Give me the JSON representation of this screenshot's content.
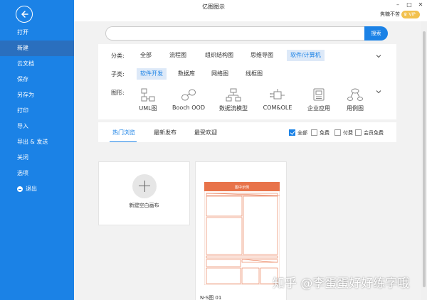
{
  "window": {
    "title": "亿图图示",
    "user": "焦糖不苦",
    "vip_badge": "VIP",
    "controls": [
      "–",
      "□",
      "✕"
    ]
  },
  "sidebar": {
    "items": [
      {
        "label": "打开"
      },
      {
        "label": "新建"
      },
      {
        "label": "云文档"
      },
      {
        "label": "保存"
      },
      {
        "label": "另存为"
      },
      {
        "label": "打印"
      },
      {
        "label": "导入"
      },
      {
        "label": "导出 & 发送"
      },
      {
        "label": "关闭"
      },
      {
        "label": "选项"
      },
      {
        "label": "退出"
      }
    ],
    "active_index": 1
  },
  "search": {
    "placeholder": "",
    "button_label": "搜索"
  },
  "filters": {
    "category": {
      "label": "分类:",
      "options": [
        "全部",
        "流程图",
        "组织结构图",
        "思维导图",
        "软件/计算机"
      ]
    },
    "subcategory": {
      "label": "子类:",
      "options": [
        "软件开发",
        "数据库",
        "网络图",
        "线框图"
      ]
    },
    "shapes": {
      "label": "图形:",
      "options": [
        "UML图",
        "Booch OOD",
        "数据流模型",
        "COM&OLE",
        "企业应用",
        "用例图"
      ]
    }
  },
  "tabs": {
    "items": [
      "热门浏览",
      "最新发布",
      "最受欢迎"
    ],
    "filters": [
      {
        "label": "全部",
        "checked": true
      },
      {
        "label": "免费",
        "checked": false
      },
      {
        "label": "付费",
        "checked": false
      },
      {
        "label": "会员免费",
        "checked": false
      }
    ]
  },
  "cards": {
    "new_blank_label": "新建空白画布",
    "template_name": "N-S图 01",
    "template_header_text": "图中示例"
  },
  "watermark": "知乎 @李蛋蛋好好练字哦",
  "colors": {
    "sidebar": "#1b82e6",
    "accent": "#1b82e6",
    "selected_chip_bg": "#dde9f8",
    "vip": "#f2c14e",
    "template_accent": "#e8734a"
  }
}
